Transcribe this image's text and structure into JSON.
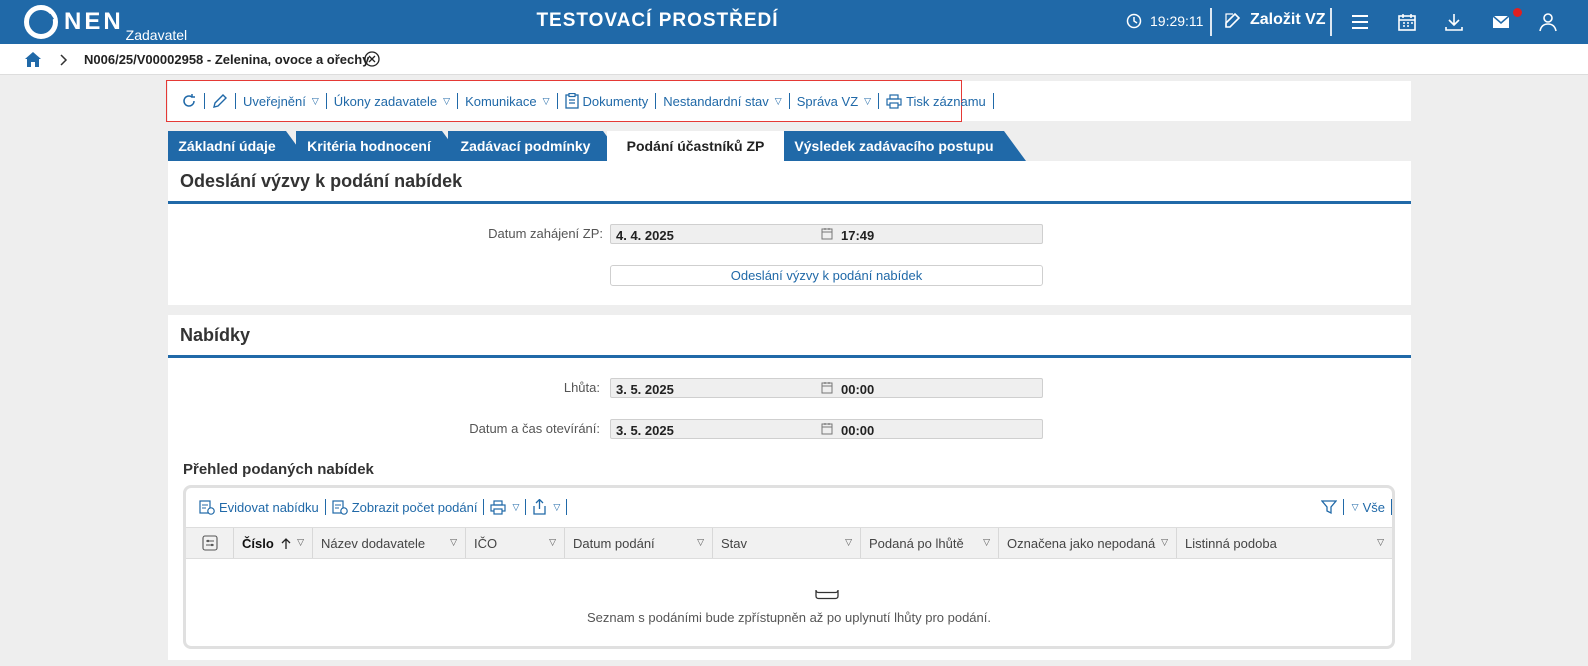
{
  "topbar": {
    "logo_text": "NEN",
    "logo_sub": "Zadavatel",
    "env_title": "TESTOVACÍ PROSTŘEDÍ",
    "clock": "19:29:11",
    "create_label": "Založit VZ",
    "icons": [
      "menu-icon",
      "calendar-icon",
      "download-icon",
      "mail-icon",
      "user-icon"
    ],
    "accent": "#2069a8",
    "badge_color": "#e02020"
  },
  "breadcrumb": {
    "title": "N006/25/V00002958 - Zelenina, ovoce a ořechy"
  },
  "toolbar": {
    "publish": "Uveřejnění",
    "actions": "Úkony zadavatele",
    "communication": "Komunikace",
    "documents": "Dokumenty",
    "nonstandard": "Nestandardní stav",
    "management": "Správa VZ",
    "print": "Tisk záznamu"
  },
  "tabs": [
    {
      "label": "Základní údaje"
    },
    {
      "label": "Kritéria hodnocení"
    },
    {
      "label": "Zadávací podmínky"
    },
    {
      "label": "Podání účastníků ZP"
    },
    {
      "label": "Výsledek zadávacího postupu"
    }
  ],
  "panel1": {
    "heading": "Odeslání výzvy k podání nabídek",
    "start_label": "Datum zahájení ZP:",
    "start_date": "4. 4. 2025",
    "start_time": "17:49",
    "send_button": "Odeslání výzvy k podání nabídek"
  },
  "panel2": {
    "heading": "Nabídky",
    "deadline_label": "Lhůta:",
    "deadline_date": "3. 5. 2025",
    "deadline_time": "00:00",
    "opening_label": "Datum a čas otevírání:",
    "opening_date": "3. 5. 2025",
    "opening_time": "00:00",
    "overview_title": "Přehled podaných nabídek",
    "grid": {
      "register": "Evidovat nabídku",
      "show_count": "Zobrazit počet podání",
      "filter_all": "Vše",
      "columns": [
        "Číslo",
        "Název dodavatele",
        "IČO",
        "Datum podání",
        "Stav",
        "Podaná po lhůtě",
        "Označena jako nepodaná",
        "Listinná podoba"
      ],
      "empty_message": "Seznam s podáními bude zpřístupněn až po uplynutí lhůty pro podání."
    }
  }
}
